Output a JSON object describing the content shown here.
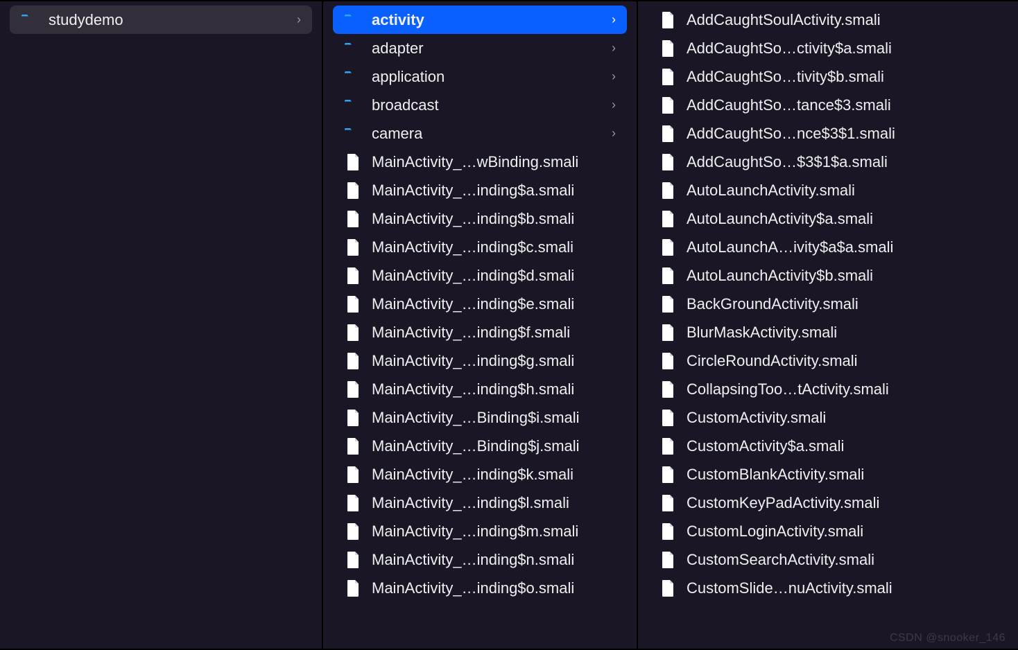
{
  "columns": {
    "col1": [
      {
        "type": "folder",
        "label": "studydemo",
        "hasChildren": true,
        "state": "dim"
      }
    ],
    "col2": [
      {
        "type": "folder",
        "label": "activity",
        "hasChildren": true,
        "state": "selected"
      },
      {
        "type": "folder",
        "label": "adapter",
        "hasChildren": true
      },
      {
        "type": "folder",
        "label": "application",
        "hasChildren": true
      },
      {
        "type": "folder",
        "label": "broadcast",
        "hasChildren": true
      },
      {
        "type": "folder",
        "label": "camera",
        "hasChildren": true
      },
      {
        "type": "file",
        "label": "MainActivity_…wBinding.smali"
      },
      {
        "type": "file",
        "label": "MainActivity_…inding$a.smali"
      },
      {
        "type": "file",
        "label": "MainActivity_…inding$b.smali"
      },
      {
        "type": "file",
        "label": "MainActivity_…inding$c.smali"
      },
      {
        "type": "file",
        "label": "MainActivity_…inding$d.smali"
      },
      {
        "type": "file",
        "label": "MainActivity_…inding$e.smali"
      },
      {
        "type": "file",
        "label": "MainActivity_…inding$f.smali"
      },
      {
        "type": "file",
        "label": "MainActivity_…inding$g.smali"
      },
      {
        "type": "file",
        "label": "MainActivity_…inding$h.smali"
      },
      {
        "type": "file",
        "label": "MainActivity_…Binding$i.smali"
      },
      {
        "type": "file",
        "label": "MainActivity_…Binding$j.smali"
      },
      {
        "type": "file",
        "label": "MainActivity_…inding$k.smali"
      },
      {
        "type": "file",
        "label": "MainActivity_…inding$l.smali"
      },
      {
        "type": "file",
        "label": "MainActivity_…inding$m.smali"
      },
      {
        "type": "file",
        "label": "MainActivity_…inding$n.smali"
      },
      {
        "type": "file",
        "label": "MainActivity_…inding$o.smali"
      }
    ],
    "col3": [
      {
        "type": "file",
        "label": "AddCaughtSoulActivity.smali"
      },
      {
        "type": "file",
        "label": "AddCaughtSo…ctivity$a.smali"
      },
      {
        "type": "file",
        "label": "AddCaughtSo…tivity$b.smali"
      },
      {
        "type": "file",
        "label": "AddCaughtSo…tance$3.smali"
      },
      {
        "type": "file",
        "label": "AddCaughtSo…nce$3$1.smali"
      },
      {
        "type": "file",
        "label": "AddCaughtSo…$3$1$a.smali"
      },
      {
        "type": "file",
        "label": "AutoLaunchActivity.smali"
      },
      {
        "type": "file",
        "label": "AutoLaunchActivity$a.smali"
      },
      {
        "type": "file",
        "label": "AutoLaunchA…ivity$a$a.smali"
      },
      {
        "type": "file",
        "label": "AutoLaunchActivity$b.smali"
      },
      {
        "type": "file",
        "label": "BackGroundActivity.smali"
      },
      {
        "type": "file",
        "label": "BlurMaskActivity.smali"
      },
      {
        "type": "file",
        "label": "CircleRoundActivity.smali"
      },
      {
        "type": "file",
        "label": "CollapsingToo…tActivity.smali"
      },
      {
        "type": "file",
        "label": "CustomActivity.smali"
      },
      {
        "type": "file",
        "label": "CustomActivity$a.smali"
      },
      {
        "type": "file",
        "label": "CustomBlankActivity.smali"
      },
      {
        "type": "file",
        "label": "CustomKeyPadActivity.smali"
      },
      {
        "type": "file",
        "label": "CustomLoginActivity.smali"
      },
      {
        "type": "file",
        "label": "CustomSearchActivity.smali"
      },
      {
        "type": "file",
        "label": "CustomSlide…nuActivity.smali"
      }
    ]
  },
  "watermark": "CSDN @snooker_146"
}
